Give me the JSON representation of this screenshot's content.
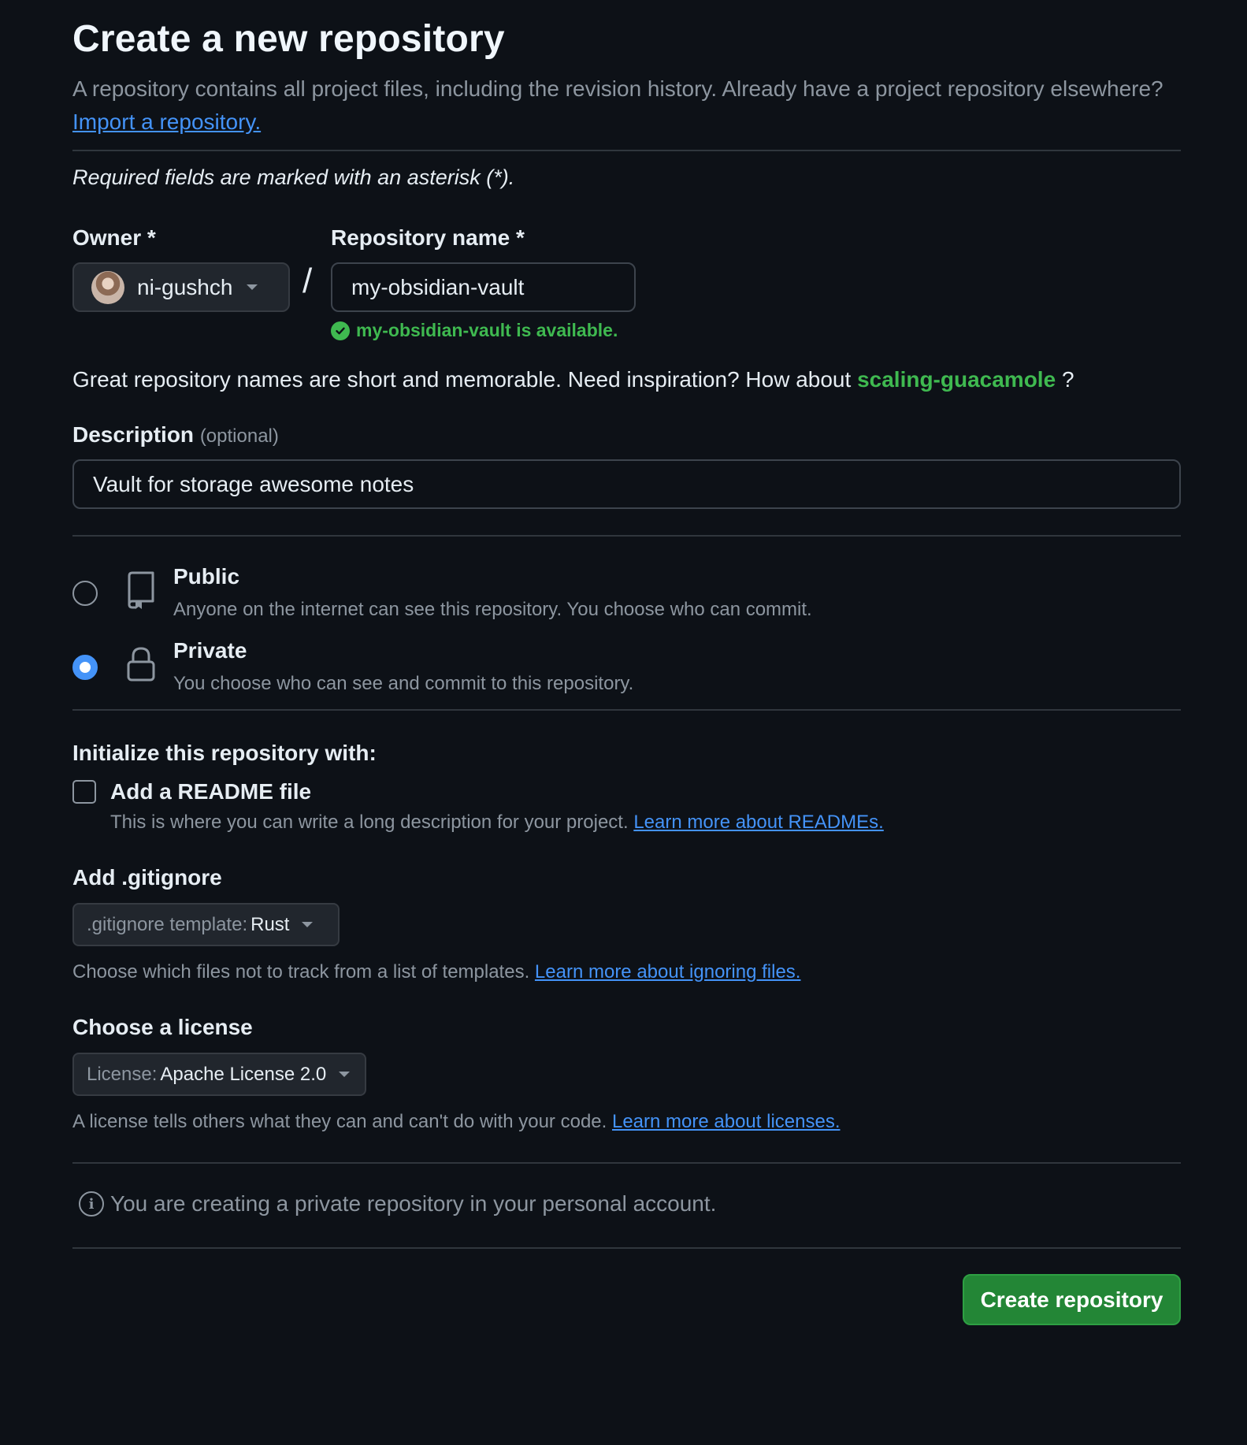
{
  "header": {
    "title": "Create a new repository",
    "subtitle_text": "A repository contains all project files, including the revision history. Already have a project repository elsewhere?",
    "import_link": "Import a repository."
  },
  "required_note": "Required fields are marked with an asterisk (*).",
  "owner": {
    "label": "Owner *",
    "value": "ni-gushch"
  },
  "separator": "/",
  "repo_name": {
    "label": "Repository name *",
    "value": "my-obsidian-vault",
    "availability": "my-obsidian-vault is available."
  },
  "inspiration": {
    "text": "Great repository names are short and memorable. Need inspiration? How about",
    "suggestion": "scaling-guacamole",
    "suffix": "?"
  },
  "description": {
    "label": "Description",
    "optional": "(optional)",
    "value": "Vault for storage awesome notes"
  },
  "visibility": {
    "selected": "Private",
    "options": [
      {
        "title": "Public",
        "desc": "Anyone on the internet can see this repository. You choose who can commit.",
        "icon": "repo-icon"
      },
      {
        "title": "Private",
        "desc": "You choose who can see and commit to this repository.",
        "icon": "lock-icon"
      }
    ]
  },
  "initialize": {
    "heading": "Initialize this repository with:",
    "readme_label": "Add a README file",
    "readme_checked": false,
    "readme_desc": "This is where you can write a long description for your project.",
    "readme_link": "Learn more about READMEs."
  },
  "gitignore": {
    "heading": "Add .gitignore",
    "select_prefix": ".gitignore template:",
    "select_value": "Rust",
    "desc": "Choose which files not to track from a list of templates.",
    "link": "Learn more about ignoring files."
  },
  "license": {
    "heading": "Choose a license",
    "select_prefix": "License:",
    "select_value": "Apache License 2.0",
    "desc": "A license tells others what they can and can't do with your code.",
    "link": "Learn more about licenses."
  },
  "info_message": "You are creating a private repository in your personal account.",
  "submit_label": "Create repository",
  "colors": {
    "background": "#0d1117",
    "accent_blue": "#4493f8",
    "success_green": "#3fb950",
    "button_green": "#238636"
  }
}
